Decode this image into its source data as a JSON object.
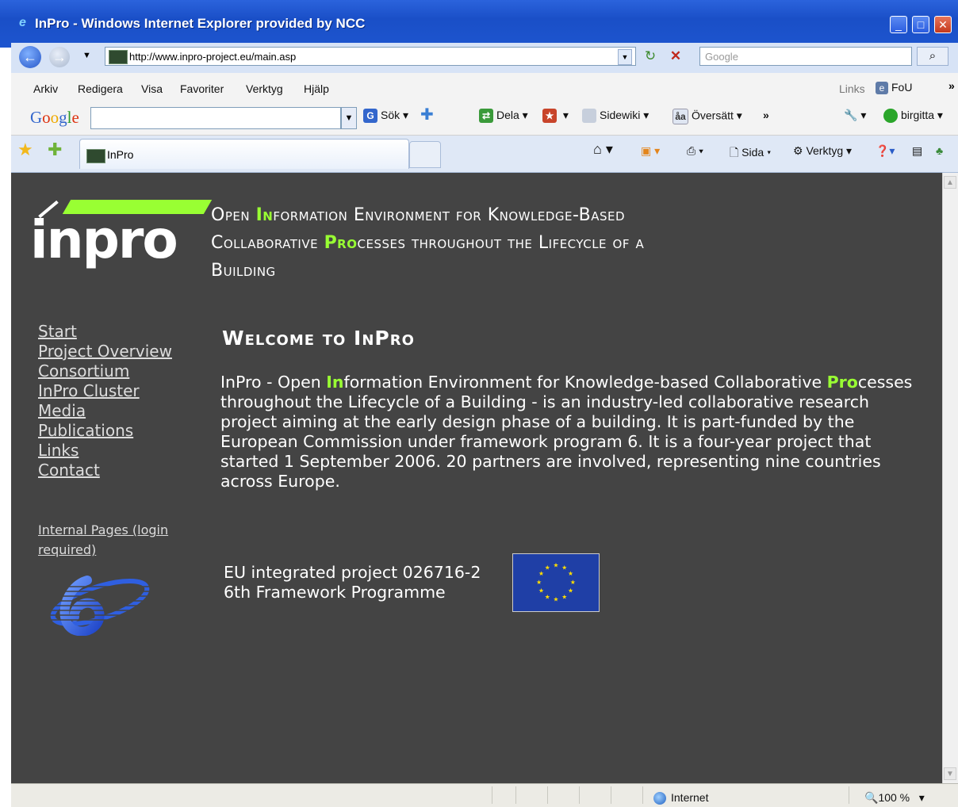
{
  "window": {
    "title": "InPro - Windows Internet Explorer provided by NCC"
  },
  "address_bar": {
    "url": "http://www.inpro-project.eu/main.asp",
    "search_placeholder": "Google"
  },
  "menu": {
    "items": [
      "Arkiv",
      "Redigera",
      "Visa",
      "Favoriter",
      "Verktyg",
      "Hjälp"
    ],
    "links_label": "Links",
    "fou_label": "FoU"
  },
  "google_toolbar": {
    "logo": "Google",
    "search_label": "Sök",
    "share_label": "Dela",
    "sidewiki_label": "Sidewiki",
    "translate_label": "Översätt",
    "user_label": "birgitta"
  },
  "tabs": {
    "active_tab": "InPro"
  },
  "command_bar": {
    "page_label": "Sida",
    "tools_label": "Verktyg"
  },
  "page": {
    "header": {
      "line1_pre": "Open ",
      "line1_hl": "In",
      "line1_post": "formation Environment for Knowledge-Based",
      "line2_pre": "Collaborative ",
      "line2_hl": "Pro",
      "line2_post": "cesses throughout the Lifecycle of a",
      "line3": "Building"
    },
    "logo_text": "inpro",
    "nav": [
      "Start",
      "Project Overview",
      "Consortium",
      "InPro Cluster",
      "Media",
      "Publications",
      "Links",
      "Contact"
    ],
    "internal_link": "Internal Pages (login required)",
    "welcome": "Welcome to InPro",
    "intro": {
      "part1": "InPro - Open ",
      "hl1": "In",
      "part2": "formation Environment for Knowledge-based Collaborative ",
      "hl2": "Pro",
      "part3": "cesses throughout the Lifecycle of a Building - is an industry-led collaborative research project aiming at the early design phase of a building. It is part-funded by the European Commission under framework program 6. It is a four-year project that started 1 September 2006. 20 partners are involved, representing nine countries across Europe."
    },
    "eu": {
      "line1": "EU integrated project 026716-2",
      "line2": "6th Framework Programme"
    }
  },
  "status_bar": {
    "zone": "Internet",
    "zoom": "100 %"
  },
  "colors": {
    "page_bg": "#444444",
    "accent_green": "#99ff33",
    "eu_blue": "#1f3fa6"
  }
}
